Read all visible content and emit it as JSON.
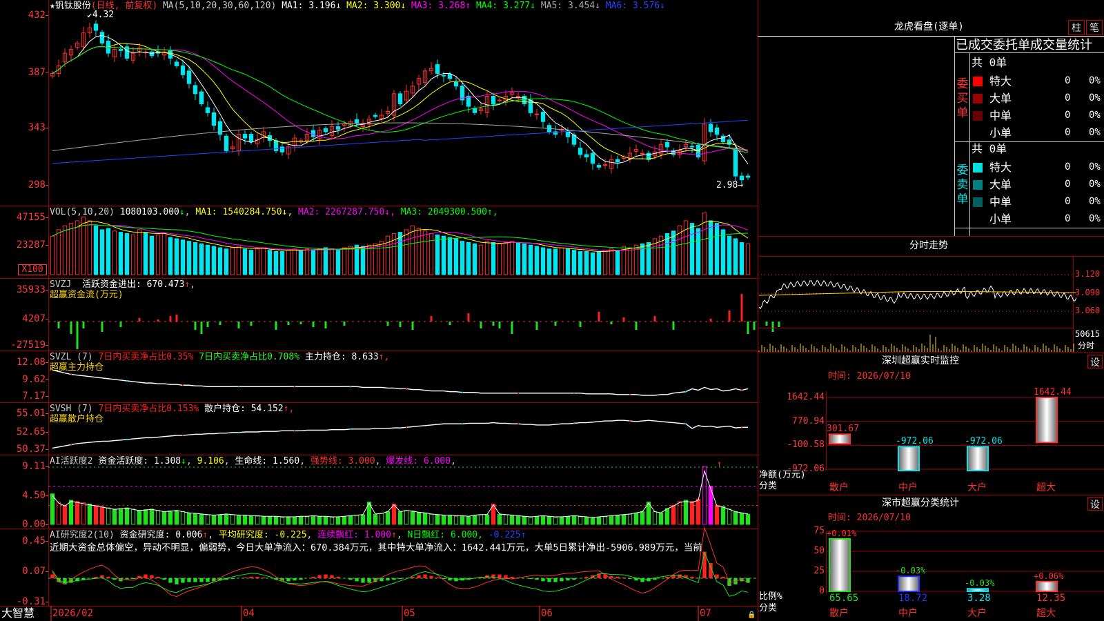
{
  "chart_data": [
    {
      "type": "candlestick",
      "title": "",
      "stock_name": "钒钛股份",
      "period_label": "(日线, 前复权)",
      "y_range": [
        2.98,
        4.32
      ],
      "y_ticks": [
        "432",
        "387",
        "343",
        "298"
      ],
      "high_label": "4.32",
      "low_label": "2.98",
      "x_ticks": [
        "2026/02",
        "04",
        "05",
        "06",
        "07"
      ],
      "ma_header": "MA(5,10,20,30,60,120)",
      "ma_values": [
        {
          "name": "MA1",
          "value": "3.196"
        },
        {
          "name": "MA2",
          "value": "3.300"
        },
        {
          "name": "MA3",
          "value": "3.268"
        },
        {
          "name": "MA4",
          "value": "3.277"
        },
        {
          "name": "MA5",
          "value": "3.454"
        },
        {
          "name": "MA6",
          "value": "3.576"
        }
      ],
      "close": [
        3.86,
        3.92,
        4.02,
        4.05,
        4.1,
        4.18,
        4.22,
        4.2,
        4.1,
        4.02,
        4.05,
        4.04,
        3.98,
        4.02,
        4.06,
        4.03,
        4.0,
        4.02,
        4.03,
        3.98,
        3.92,
        3.85,
        3.78,
        3.7,
        3.62,
        3.55,
        3.45,
        3.38,
        3.25,
        3.28,
        3.38,
        3.35,
        3.32,
        3.34,
        3.4,
        3.33,
        3.25,
        3.24,
        3.28,
        3.35,
        3.33,
        3.38,
        3.36,
        3.41,
        3.4,
        3.44,
        3.42,
        3.46,
        3.48,
        3.47,
        3.46,
        3.5,
        3.52,
        3.53,
        3.56,
        3.7,
        3.62,
        3.72,
        3.76,
        3.82,
        3.88,
        3.9,
        3.86,
        3.84,
        3.82,
        3.76,
        3.65,
        3.6,
        3.55,
        3.58,
        3.68,
        3.62,
        3.65,
        3.68,
        3.71,
        3.68,
        3.62,
        3.55,
        3.54,
        3.48,
        3.4,
        3.38,
        3.42,
        3.36,
        3.3,
        3.22,
        3.2,
        3.15,
        3.12,
        3.14,
        3.18,
        3.16,
        3.2,
        3.23,
        3.26,
        3.23,
        3.18,
        3.24,
        3.3,
        3.28,
        3.22,
        3.25,
        3.3,
        3.28,
        3.2,
        3.46,
        3.4,
        3.38,
        3.32,
        3.3,
        3.05,
        3.02,
        3.04
      ]
    },
    {
      "type": "bar",
      "title": "",
      "header": "VOL(5,10,20)",
      "vol_value": "1080103.000",
      "unit": "X100",
      "y_ticks": [
        "47155",
        "23287"
      ],
      "indicators": [
        {
          "name": "MA1",
          "value": "1540284.750"
        },
        {
          "name": "MA2",
          "value": "2267287.750"
        },
        {
          "name": "MA3",
          "value": "2049300.500"
        }
      ],
      "values": [
        30,
        35,
        38,
        40,
        42,
        45,
        42,
        38,
        35,
        36,
        34,
        33,
        32,
        31,
        35,
        33,
        30,
        31,
        32,
        29,
        28,
        27,
        26,
        25,
        24,
        23,
        22,
        21,
        20,
        21,
        22,
        20,
        19,
        20,
        21,
        19,
        18,
        18,
        19,
        20,
        19,
        20,
        19,
        20,
        21,
        20,
        19,
        21,
        22,
        23,
        22,
        23,
        24,
        26,
        30,
        32,
        33,
        35,
        38,
        36,
        34,
        32,
        31,
        30,
        29,
        28,
        26,
        25,
        24,
        23,
        26,
        25,
        24,
        25,
        26,
        25,
        24,
        23,
        22,
        21,
        20,
        20,
        21,
        20,
        19,
        18,
        18,
        17,
        18,
        19,
        20,
        19,
        22,
        21,
        23,
        24,
        25,
        28,
        30,
        32,
        34,
        38,
        42,
        40,
        36,
        48,
        42,
        40,
        35,
        30,
        28,
        25,
        24
      ]
    },
    {
      "type": "bar",
      "title": "",
      "header": "SVZJ",
      "subtitle": "超赢资金流(万元)",
      "label": "活跃资金进出:",
      "value": "670.473",
      "y_ticks": [
        "35933",
        "4207",
        "-27519"
      ],
      "values": [
        0,
        -10,
        0,
        -18,
        -40,
        -10,
        0,
        0,
        -15,
        0,
        0,
        -8,
        0,
        0,
        5,
        0,
        0,
        3,
        0,
        8,
        10,
        0,
        0,
        -12,
        -18,
        -8,
        0,
        -5,
        0,
        0,
        -10,
        0,
        -6,
        0,
        0,
        0,
        -12,
        0,
        -5,
        0,
        -4,
        0,
        -8,
        0,
        -10,
        0,
        0,
        -6,
        0,
        0,
        0,
        0,
        0,
        0,
        -6,
        0,
        -8,
        0,
        -12,
        0,
        0,
        8,
        0,
        0,
        -5,
        0,
        0,
        12,
        0,
        -10,
        0,
        -6,
        -10,
        0,
        -18,
        0,
        0,
        0,
        -12,
        0,
        0,
        -6,
        0,
        0,
        0,
        -8,
        0,
        0,
        14,
        0,
        -4,
        0,
        6,
        0,
        -12,
        0,
        0,
        8,
        0,
        0,
        -12,
        0,
        0,
        0,
        0,
        0,
        4,
        0,
        0,
        16,
        0,
        40,
        -18,
        -12,
        0,
        -6,
        -15,
        -8
      ]
    },
    {
      "type": "line",
      "title": "",
      "header": "SVZL (7)",
      "subtitle": "超赢主力持仓",
      "segments": [
        {
          "text": "7日内买卖净占比0.35%",
          "color": "#ff2020"
        },
        {
          "text": "7日内买卖净占比0.708%",
          "color": "#20ff20"
        },
        {
          "text": "主力持仓: 8.633",
          "color": "#ffffff"
        }
      ],
      "y_ticks": [
        "12.08",
        "9.62",
        "7.17"
      ],
      "values": [
        11.2,
        11.0,
        10.8,
        10.6,
        10.5,
        10.4,
        10.3,
        10.2,
        10.1,
        10.0,
        9.9,
        9.8,
        9.7,
        9.6,
        9.5,
        9.4,
        9.4,
        9.3,
        9.3,
        9.2,
        9.2,
        9.1,
        9.1,
        9.0,
        9.0,
        8.9,
        8.9,
        8.9,
        8.9,
        8.9,
        8.9,
        8.9,
        8.9,
        8.9,
        8.9,
        8.9,
        8.9,
        8.9,
        8.9,
        8.9,
        8.9,
        8.9,
        8.9,
        8.9,
        8.9,
        8.9,
        8.9,
        8.9,
        8.9,
        8.9,
        8.8,
        8.8,
        8.8,
        8.8,
        8.7,
        8.7,
        8.6,
        8.6,
        8.5,
        8.5,
        8.4,
        8.3,
        8.3,
        8.3,
        8.2,
        8.2,
        8.1,
        8.1,
        8.1,
        8.0,
        8.0,
        8.0,
        8.0,
        8.0,
        8.0,
        8.0,
        8.0,
        8.0,
        8.0,
        8.0,
        8.0,
        8.0,
        8.0,
        8.0,
        8.0,
        8.0,
        7.9,
        7.9,
        7.9,
        7.9,
        7.9,
        7.8,
        7.8,
        7.8,
        7.8,
        7.7,
        7.7,
        7.7,
        7.8,
        7.8,
        8.0,
        8.1,
        8.2,
        8.6,
        8.4,
        8.8,
        8.5,
        8.6,
        8.3,
        8.4,
        8.6,
        8.4,
        8.6
      ]
    },
    {
      "type": "line",
      "title": "",
      "header": "SVSH (7)",
      "subtitle": "超赢散户持仓",
      "segments": [
        {
          "text": "7日内买卖净占比0.153%",
          "color": "#ff2020"
        },
        {
          "text": "散户持仓: 54.152",
          "color": "#ffffff"
        }
      ],
      "y_ticks": [
        "55.01",
        "52.65",
        "50.37"
      ],
      "values": [
        50.6,
        50.8,
        51.0,
        51.2,
        51.4,
        51.5,
        51.6,
        51.7,
        51.8,
        51.8,
        51.9,
        52.0,
        52.1,
        52.2,
        52.3,
        52.4,
        52.4,
        52.5,
        52.6,
        52.7,
        52.8,
        52.8,
        52.9,
        53.0,
        53.0,
        53.1,
        53.1,
        53.2,
        53.2,
        53.3,
        53.3,
        53.4,
        53.4,
        53.4,
        53.5,
        53.5,
        53.5,
        53.6,
        53.6,
        53.6,
        53.6,
        53.7,
        53.7,
        53.7,
        53.7,
        53.8,
        53.8,
        53.8,
        53.9,
        53.9,
        53.9,
        53.9,
        54.0,
        54.0,
        54.0,
        54.1,
        54.1,
        54.2,
        54.3,
        54.4,
        54.5,
        54.6,
        54.7,
        54.8,
        54.8,
        54.8,
        54.8,
        54.9,
        54.9,
        54.9,
        54.9,
        55.0,
        54.9,
        54.9,
        54.8,
        54.8,
        54.7,
        54.7,
        54.6,
        54.6,
        54.6,
        54.7,
        54.8,
        54.8,
        54.9,
        55.0,
        55.0,
        55.1,
        55.2,
        55.3,
        55.3,
        55.4,
        55.4,
        55.3,
        55.2,
        55.3,
        55.4,
        55.3,
        55.2,
        55.1,
        55.0,
        54.9,
        54.8,
        54.0,
        54.5,
        54.3,
        54.4,
        54.2,
        54.3,
        54.4,
        54.1,
        54.2,
        54.2
      ]
    },
    {
      "type": "bar",
      "title": "",
      "header": "AI活跃度2",
      "label": "资金活跃度: 1.308",
      "value2": "9.106",
      "label3": "生命线: 1.560",
      "label4": "强势线: 3.000",
      "label5": "爆发线: 6.000",
      "y_ticks": [
        "9.11",
        "4.50",
        "0.00"
      ],
      "values": [
        4.8,
        3.5,
        3.0,
        3.8,
        3.6,
        3.4,
        3.2,
        3.0,
        2.8,
        2.6,
        2.4,
        2.5,
        2.6,
        2.4,
        2.2,
        2.3,
        2.4,
        2.2,
        2.0,
        2.1,
        2.2,
        2.0,
        1.8,
        1.7,
        1.6,
        1.5,
        1.4,
        1.5,
        1.6,
        1.5,
        1.4,
        1.4,
        1.3,
        1.3,
        1.2,
        1.2,
        1.2,
        1.1,
        1.1,
        1.1,
        1.2,
        1.2,
        1.3,
        1.2,
        1.2,
        1.1,
        1.1,
        1.2,
        1.3,
        1.4,
        1.5,
        3.5,
        1.6,
        1.7,
        2.0,
        3.2,
        2.0,
        2.2,
        2.1,
        1.9,
        1.8,
        1.6,
        1.5,
        1.4,
        1.4,
        1.3,
        1.3,
        1.2,
        1.4,
        1.5,
        1.5,
        3.2,
        1.6,
        1.5,
        1.4,
        1.3,
        1.2,
        1.1,
        1.2,
        1.3,
        1.2,
        1.1,
        1.1,
        1.2,
        1.3,
        1.2,
        1.1,
        1.0,
        1.1,
        1.2,
        1.3,
        1.4,
        1.5,
        1.6,
        1.8,
        2.0,
        3.5,
        2.0,
        1.8,
        2.5,
        3.0,
        3.6,
        3.8,
        3.6,
        4.0,
        9.1,
        6.0,
        3.0,
        2.8,
        2.4,
        2.0,
        1.8,
        1.6
      ]
    },
    {
      "type": "bar",
      "title": "",
      "header": "AI研究度2(10)",
      "label": "资金研究度: 0.006",
      "label2": "平均研究度: -0.225",
      "label3": "连续飘红: 1.000",
      "label4": "N日飘红: 6.000,",
      "label5": "-0.225",
      "y_ticks": [
        "0.45",
        "0.07",
        "-0.31"
      ],
      "text_line": "近期大资金总体偏空，异动不明显，偏弱势，今日大单净流入：670.384万元，其中特大单净流入：1642.441万元，大单5日累计净出-5906.989万元，当前",
      "values": [
        0.05,
        -0.05,
        -0.08,
        -0.06,
        -0.04,
        -0.02,
        0.0,
        0.02,
        0.04,
        0.02,
        -0.02,
        -0.04,
        -0.02,
        -0.01,
        0.03,
        0.05,
        0.04,
        0.02,
        -0.02,
        -0.06,
        -0.08,
        -0.06,
        -0.05,
        -0.05,
        -0.05,
        -0.05,
        -0.04,
        -0.03,
        -0.02,
        -0.01,
        0.0,
        0.01,
        0.02,
        0.02,
        0.01,
        0.0,
        -0.02,
        -0.03,
        -0.04,
        -0.03,
        -0.02,
        0.0,
        0.02,
        0.04,
        0.05,
        0.04,
        0.02,
        0.0,
        -0.02,
        -0.04,
        -0.06,
        -0.06,
        -0.05,
        -0.04,
        -0.03,
        -0.02,
        -0.01,
        0.0,
        0.02,
        0.04,
        0.05,
        0.03,
        0.01,
        -0.01,
        -0.03,
        -0.04,
        -0.03,
        -0.02,
        0.0,
        0.02,
        0.04,
        0.05,
        0.05,
        0.04,
        0.02,
        0.01,
        0.0,
        -0.01,
        -0.02,
        -0.04,
        -0.05,
        -0.05,
        -0.04,
        -0.03,
        -0.02,
        0.0,
        0.02,
        0.04,
        0.06,
        0.05,
        0.03,
        0.02,
        0.01,
        -0.01,
        -0.03,
        -0.05,
        -0.04,
        -0.02,
        0.0,
        0.02,
        0.04,
        0.05,
        0.04,
        0.02,
        0.01,
        0.35,
        0.2,
        0.05,
        0.02,
        -0.1,
        -0.08,
        -0.04,
        -0.06
      ]
    }
  ],
  "app": {
    "name": "大智慧"
  },
  "right_panel": {
    "top_title": "龙虎看盘(逐单)",
    "btn1": "柱",
    "btn2": "笔",
    "header": "已成交委托单成交量统计",
    "buy": {
      "label": "委买单",
      "total": "共 0单",
      "rows": [
        {
          "name": "特大",
          "value": "0",
          "pct": "0%",
          "color": "#ff0000"
        },
        {
          "name": "大单",
          "value": "0",
          "pct": "0%",
          "color": "#990000"
        },
        {
          "name": "中单",
          "value": "0",
          "pct": "0%",
          "color": "#6b0000"
        },
        {
          "name": "小单",
          "value": "0",
          "pct": "0%",
          "color": "#000000"
        }
      ]
    },
    "sell": {
      "label": "委卖单",
      "total": "共 0单",
      "rows": [
        {
          "name": "特大",
          "value": "0",
          "pct": "0%",
          "color": "#00e0e0"
        },
        {
          "name": "大单",
          "value": "0",
          "pct": "0%",
          "color": "#008080"
        },
        {
          "name": "中单",
          "value": "0",
          "pct": "0%",
          "color": "#006060"
        },
        {
          "name": "小单",
          "value": "0",
          "pct": "0%",
          "color": "#000000"
        }
      ]
    },
    "intraday": {
      "title": "分时走势",
      "y_ticks": [
        "3.120",
        "3.090",
        "3.060"
      ],
      "vol_label": "50615",
      "vol_unit": "分时"
    },
    "monitor": {
      "title": "深圳超赢实时监控",
      "date": "时间: 2026/07/10",
      "btn": "设",
      "y_ticks": [
        "1642.44",
        "770.94",
        "-100.58",
        "-972.06"
      ],
      "bars": [
        {
          "cat": "散户",
          "value": 301.67,
          "label": "301.67"
        },
        {
          "cat": "中户",
          "value": -972.06,
          "label": "-972.06"
        },
        {
          "cat": "大户",
          "value": -972.06,
          "label": "-972.06"
        },
        {
          "cat": "超大",
          "value": 1642.44,
          "label": "1642.44"
        }
      ],
      "ylabel1": "净额(万元)",
      "ylabel2": "分类"
    },
    "stats": {
      "title": "深市超赢分类统计",
      "date": "时间: 2026/07/10",
      "btn": "设",
      "y_ticks": [
        "75",
        "50",
        "25",
        "0"
      ],
      "bars": [
        {
          "cat": "散户",
          "value": 65.65,
          "label": "65.65",
          "delta": "+0.01%"
        },
        {
          "cat": "中户",
          "value": 18.72,
          "label": "18.72",
          "delta": "-0.03%"
        },
        {
          "cat": "大户",
          "value": 3.28,
          "label": "3.28",
          "delta": "-0.03%"
        },
        {
          "cat": "超大",
          "value": 12.35,
          "label": "12.35",
          "delta": "+0.06%"
        }
      ],
      "ylabel1": "比例%",
      "ylabel2": "分类"
    }
  },
  "colors": {
    "up": "#ff3030",
    "down": "#00e5ee",
    "grid": "#a00000",
    "ma1": "#ffffff",
    "ma2": "#ffff00",
    "ma3": "#ff00ff",
    "ma4": "#00ff00",
    "ma5": "#aaaaaa",
    "ma6": "#2244ff"
  }
}
